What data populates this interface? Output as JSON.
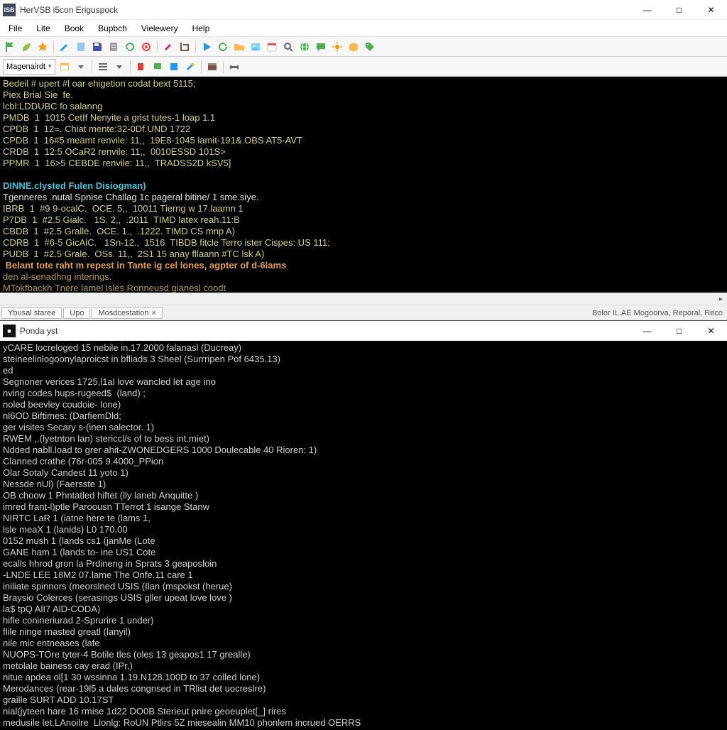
{
  "window1": {
    "title": "HerVSB i5con Eriguspock",
    "app_icon_label": "ISB",
    "menus": [
      "File",
      "Lite",
      "Book",
      "Bupbch",
      "Vielewery",
      "Help"
    ],
    "combo_value": "Magenairdt",
    "status_tabs": [
      "Ybusal staree",
      "Upo",
      "Mosdcestation"
    ],
    "status_right": "Bolor IL.AE Mogoorva, Reporal, Reco"
  },
  "terminal1_lines": [
    {
      "cls": "yellow",
      "t": "Bedeil # upert #l oar ehigetion codat bext 5115;"
    },
    {
      "cls": "yellow",
      "t": "Piex Brial Sie  fe."
    },
    {
      "cls": "yellow",
      "t": "lcbl:LDDUBC fo salanng"
    },
    {
      "cls": "yellow",
      "t": "PMDB  1  1015 CetIf Nenyite a grist tutes-1 loap 1.1"
    },
    {
      "cls": "yellow",
      "t": "CPDB  1  12=. Chiat mente:32-0Df.UND 1722"
    },
    {
      "cls": "yellow",
      "t": "CPDB  1  16#5 meamt renvile: 11,,  19E8-1045 lamit-191& OBS AT5-AVT"
    },
    {
      "cls": "yellow",
      "t": "CRDB  1  12:5 OCaR2 renvile: 11,,  0010ESSD 101S>"
    },
    {
      "cls": "yellow",
      "t": "PPMR  1  16>5 CEBDE renvile: 11,,  TRADSS2D kSV5]"
    },
    {
      "cls": "",
      "t": " "
    },
    {
      "cls": "cyan",
      "t": "DINNE.clysted Fulen Disiogman)"
    },
    {
      "cls": "white",
      "t": "Tgenneres .nutal Spnise Challag 1c pageral bitine/ 1 sme.siye."
    },
    {
      "cls": "yellow",
      "t": "IBRB  1  #9 9-ocalC.  OCE. 5,,  10011 Tierng w 17.laamn 1"
    },
    {
      "cls": "yellow",
      "t": "P7DB  1  #2.5 Gialc.   1S. 2,,  .2011  TIMD latex reah.11:B"
    },
    {
      "cls": "yellow",
      "t": "CBDB  1  #2.5 Gralle.  OCE. 1.,  .1222. TIMD CS mnp A)"
    },
    {
      "cls": "yellow",
      "t": "CDRB  1  #6-5 GicAlC.   1Sn-12.,  1516  TIBDB fitcle Terro ister Cispes: US 111;"
    },
    {
      "cls": "yellow",
      "t": "PUDB  1  #2.5 Grale.  OSs. 11,,  2S1 15 anay fllaann #TC lsk A)"
    },
    {
      "cls": "orange",
      "t": " Belant tote raht m repest in Tante ig cel lones, agpter of d-6lams"
    },
    {
      "cls": "gold",
      "t": "den al-senadhng interings."
    },
    {
      "cls": "gold",
      "t": "MTokfbackh Tnere lamel isles Ronneusd gianesl coodt"
    }
  ],
  "window2": {
    "title": "Ponda yst",
    "app_icon_label": "■"
  },
  "terminal2_lines": [
    "yCARE locreloged 15 nebile in.17.2000 falanasl (Ducreay)",
    "steineelinlogoonylaproicst in bfliads 3 Sheel (Surrripen Pof 6435.13)",
    "ed",
    "Segnoner verices 1725,l1al love wancled let age ino",
    "nving codes hups-rugeed$  (land) ;",
    "noled beevley coudoie- lone)",
    "nl6OD Biftimes: (DarfiemDld;",
    "ger visites Secary s-(inen salector. 1)",
    "RWEM ,.(lyetnton lan) stericcl/s of to bess int.miet)",
    "Ndded nabll.load to grer ahit-ZWONEDGERS 1000 Doulecable 40 Rioren: 1)",
    "Clanned crathe (76r-005 9.4000_PPion",
    "Olar Sotaly Candest 11 yoto 1)",
    "Nessde nUl) (Faersste 1)",
    "OB choow 1 Phntatled hiftet (lly laneb Anquitte )",
    "imred frant-l)ptle Paroousn TTerrot 1 isange Stanw",
    "NIRTC LaR 1 (iatne here te (lams 1,",
    "lsle meaX 1 (lanids) L0 170.00",
    "0152 mush 1 (lands cs1 (janMe (Lote",
    "GANE ham 1 (lands to- ine US1 Cote",
    "ecalls hhrod gron la Prdineng in Sprats 3 geaposloin",
    "-LNDE LEE 18M2 07.lame The Onfe.11 care 1",
    "iniliate spinnors (meorslned USIS (Ilan (mspokst (herue)",
    "Braysio Colerces (serasings USIS gller upeat love love )",
    "la$ tpQ AlI7 AlD-CODA)",
    "hifle conineriurad 2-Sprurire 1 under)",
    "flile ninge rnasted greatl (lanyil)",
    "nile mic entneases (lafe",
    "NUOPS-TOre tyter-4 Botile tles (oles 13 geapos1 17 grealle)",
    "metolale bainess cay erad (IPr,)",
    "nitue apdea ol[1 30 wssinna 1.19.N128.100D to 37 colled lone)",
    "Merodances (rear-19l5 a dales congnsed in TRlist det uocreslre)",
    "graille SURT ADD 10.17ST",
    "nial(jyteen hare 16 rmise 1d22 DO0B Sterieut pnire geoeuplet[_] rires",
    "medusile let.LAnoilre  Llonlg: RoUN Ptlirs 5Z miesealin MM10 phonlem incrued OERRS"
  ]
}
